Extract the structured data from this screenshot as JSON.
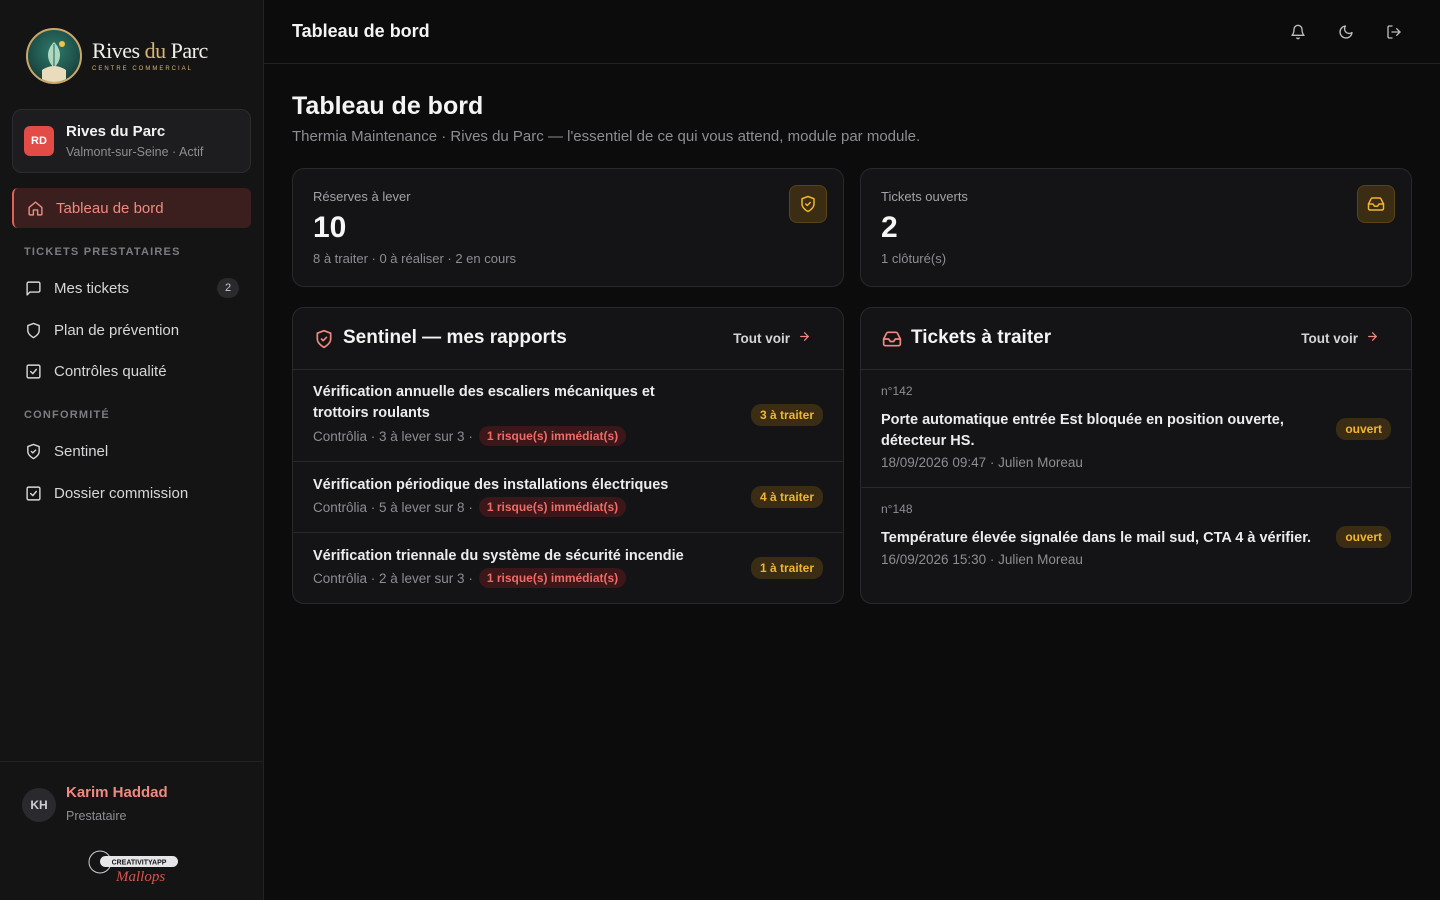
{
  "brand": {
    "name_part1": "Rives ",
    "name_part2": "du",
    "name_part3": " Parc",
    "subtitle": "CENTRE COMMERCIAL"
  },
  "site": {
    "initials": "RD",
    "name": "Rives du Parc",
    "location": "Valmont-sur-Seine · Actif"
  },
  "nav": {
    "dashboard": "Tableau de bord",
    "section_tickets": "TICKETS PRESTATAIRES",
    "my_tickets": "Mes tickets",
    "my_tickets_count": "2",
    "prevention_plan": "Plan de prévention",
    "quality_controls": "Contrôles qualité",
    "section_compliance": "CONFORMITÉ",
    "sentinel": "Sentinel",
    "commission_file": "Dossier commission"
  },
  "user": {
    "initials": "KH",
    "name": "Karim Haddad",
    "role": "Prestataire"
  },
  "topbar": {
    "title": "Tableau de bord"
  },
  "page": {
    "title": "Tableau de bord",
    "subtitle": "Thermia Maintenance · Rives du Parc — l'essentiel de ce qui vous attend, module par module."
  },
  "stats": {
    "reserves": {
      "label": "Réserves à lever",
      "value": "10",
      "detail": "8 à traiter · 0 à réaliser · 2 en cours"
    },
    "tickets": {
      "label": "Tickets ouverts",
      "value": "2",
      "detail": "1 clôturé(s)"
    }
  },
  "sentinel_panel": {
    "title": "Sentinel — mes rapports",
    "link": "Tout voir",
    "rows": [
      {
        "title": "Vérification annuelle des escaliers mécaniques et trottoirs roulants",
        "meta": "Contrôlia · 3 à lever sur 3 ·",
        "risk": "1 risque(s) immédiat(s)",
        "badge": "3 à traiter"
      },
      {
        "title": "Vérification périodique des installations électriques",
        "meta": "Contrôlia · 5 à lever sur 8 ·",
        "risk": "1 risque(s) immédiat(s)",
        "badge": "4 à traiter"
      },
      {
        "title": "Vérification triennale du système de sécurité incendie",
        "meta": "Contrôlia · 2 à lever sur 3 ·",
        "risk": "1 risque(s) immédiat(s)",
        "badge": "1 à traiter"
      }
    ]
  },
  "tickets_panel": {
    "title": "Tickets à traiter",
    "link": "Tout voir",
    "rows": [
      {
        "number": "n°142",
        "title": "Porte automatique entrée Est bloquée en position ouverte, détecteur HS.",
        "meta": "18/09/2026 09:47 · Julien Moreau",
        "status": "ouvert"
      },
      {
        "number": "n°148",
        "title": "Température élevée signalée dans le mail sud, CTA 4 à vérifier.",
        "meta": "16/09/2026 15:30 · Julien Moreau",
        "status": "ouvert"
      }
    ]
  },
  "credit": {
    "top": "CREATIVITYAPP",
    "script": "Mallops"
  },
  "colors": {
    "accent": "#e24b46",
    "accent_text": "#f08a80",
    "warning": "#f2b530",
    "danger_text": "#ef6b67"
  }
}
